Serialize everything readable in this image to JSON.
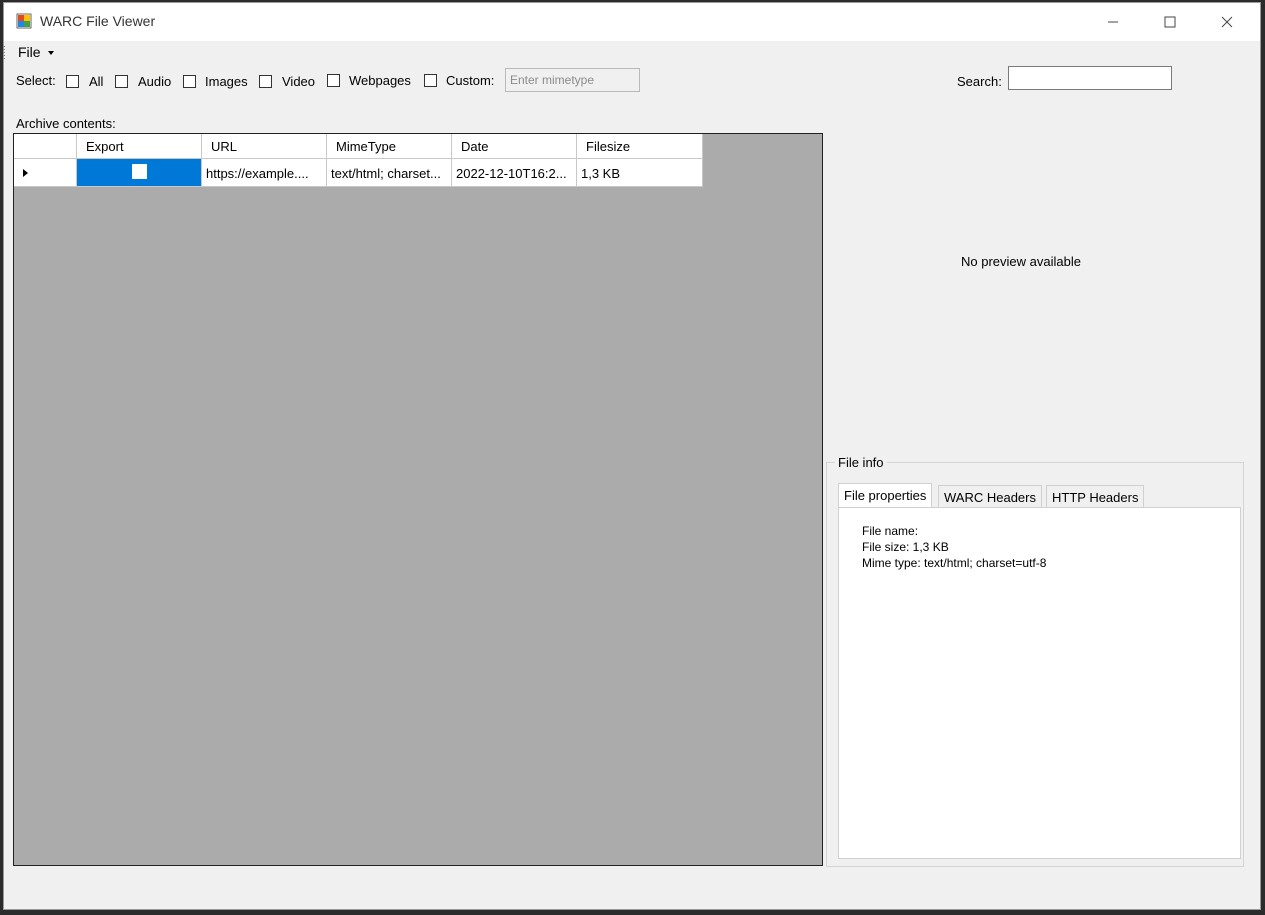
{
  "window": {
    "title": "WARC File Viewer"
  },
  "menu": {
    "file_label": "File"
  },
  "filters": {
    "select_label": "Select:",
    "options": [
      "All",
      "Audio",
      "Images",
      "Video",
      "Webpages",
      "Custom:"
    ],
    "custom_placeholder": "Enter mimetype"
  },
  "search": {
    "label": "Search:",
    "value": ""
  },
  "archive": {
    "label": "Archive contents:",
    "columns": [
      "Export",
      "URL",
      "MimeType",
      "Date",
      "Filesize"
    ],
    "rows": [
      {
        "export": false,
        "url": "https://example....",
        "mimetype": "text/html; charset...",
        "date": "2022-12-10T16:2...",
        "filesize": "1,3 KB"
      }
    ]
  },
  "preview": {
    "text": "No preview available"
  },
  "fileinfo": {
    "group_label": "File info",
    "tabs": [
      "File properties",
      "WARC Headers",
      "HTTP Headers"
    ],
    "active_tab": "File properties",
    "properties": [
      "File name:",
      "File size: 1,3 KB",
      "Mime type: text/html; charset=utf-8"
    ]
  },
  "colors": {
    "selection": "#0078d7",
    "grid_background": "#ababab",
    "window_background": "#f0f0f0"
  },
  "icons": {
    "app": "warc-app-icon",
    "minimize": "minimize-icon",
    "maximize": "maximize-icon",
    "close": "close-icon",
    "row": "row-pointer-icon"
  }
}
